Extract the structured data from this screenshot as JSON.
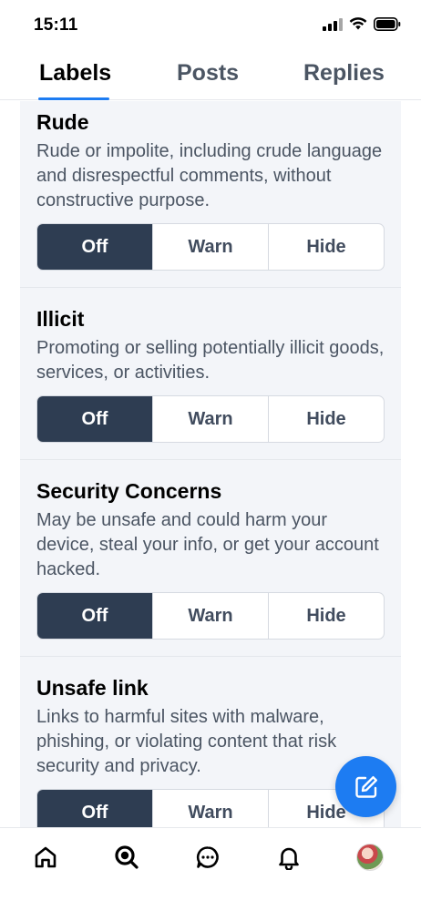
{
  "status": {
    "time": "15:11"
  },
  "tabs": [
    {
      "label": "Labels",
      "active": true
    },
    {
      "label": "Posts",
      "active": false
    },
    {
      "label": "Replies",
      "active": false
    }
  ],
  "segment_options": {
    "off": "Off",
    "warn": "Warn",
    "hide": "Hide"
  },
  "labels": [
    {
      "title": "Rude",
      "description": "Rude or impolite, including crude language and disrespectful comments, without constructive purpose.",
      "selected": "Off"
    },
    {
      "title": "Illicit",
      "description": "Promoting or selling potentially illicit goods, services, or activities.",
      "selected": "Off"
    },
    {
      "title": "Security Concerns",
      "description": "May be unsafe and could harm your device, steal your info, or get your account hacked.",
      "selected": "Off"
    },
    {
      "title": "Unsafe link",
      "description": "Links to harmful sites with malware, phishing, or violating content that risk security and privacy.",
      "selected": "Off"
    }
  ],
  "fab": {
    "icon": "compose-icon"
  },
  "bottom_nav": [
    {
      "icon": "home-icon"
    },
    {
      "icon": "search-icon"
    },
    {
      "icon": "chat-icon"
    },
    {
      "icon": "bell-icon"
    },
    {
      "icon": "avatar"
    }
  ],
  "colors": {
    "accent": "#1d7cf2",
    "selected_segment": "#2e3d52",
    "section_bg": "#f3f5f9"
  }
}
